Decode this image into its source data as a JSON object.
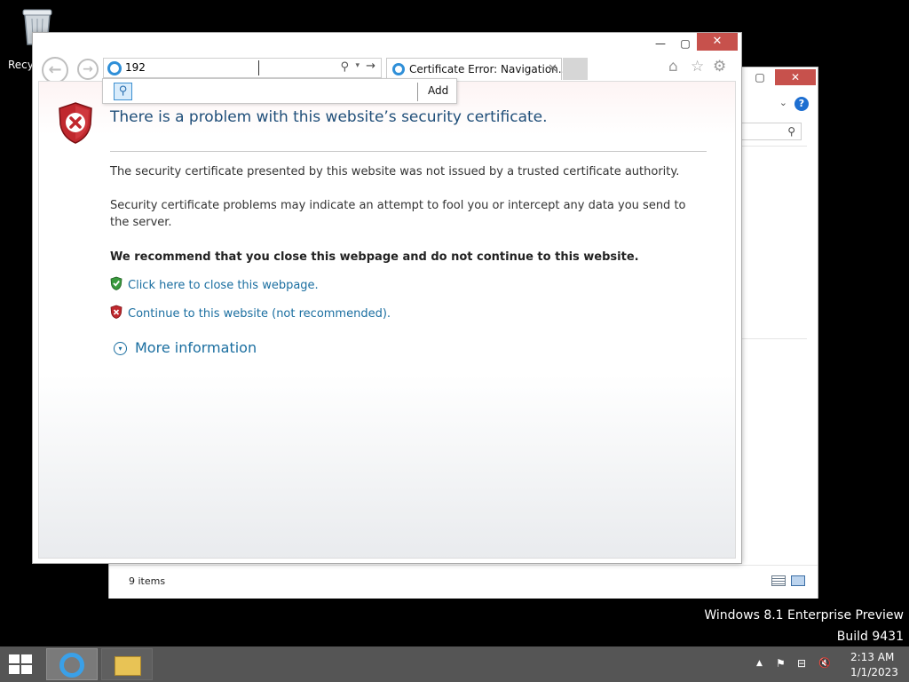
{
  "desktop": {
    "recycle_bin_label": "Recyc"
  },
  "explorer": {
    "close_glyph": "✕",
    "max_glyph": "▢",
    "help_glyph": "?",
    "chevron_glyph": "⌄",
    "search_glyph": "⚲",
    "status_count": "9 items"
  },
  "ie": {
    "min_glyph": "—",
    "max_glyph": "▢",
    "close_glyph": "✕",
    "back_glyph": "←",
    "forward_glyph": "→",
    "address_value": "192",
    "address_search_glyph": "⚲",
    "address_dropdown_glyph": "▾",
    "address_go_glyph": "→",
    "tab_title": "Certificate Error: Navigation...",
    "tab_close_glyph": "✕",
    "home_glyph": "⌂",
    "favorites_glyph": "☆",
    "tools_glyph": "⚙",
    "dropdown": {
      "search_glyph": "⚲",
      "add_label": "Add"
    }
  },
  "page": {
    "headline": "There is a problem with this website’s security certificate.",
    "para1": "The security certificate presented by this website was not issued by a trusted certificate authority.",
    "para2": "Security certificate problems may indicate an attempt to fool you or intercept any data you send to the server.",
    "recommend": "We recommend that you close this webpage and do not continue to this website.",
    "close_link": "Click here to close this webpage.",
    "continue_link": "Continue to this website (not recommended).",
    "more_info_glyph": "▾",
    "more_info": "More information"
  },
  "watermark": {
    "line1": "Windows 8.1 Enterprise Preview",
    "line2": "Build 9431"
  },
  "taskbar": {
    "tray_arrow": "▲",
    "tray_flag": "⚑",
    "tray_network": "⊟",
    "tray_volume": "🔇",
    "time": "2:13 AM",
    "date": "1/1/2023"
  },
  "colors": {
    "link": "#1a6ea0",
    "headline": "#1f4e79",
    "close_button": "#c7514c",
    "taskbar": "#555555"
  }
}
